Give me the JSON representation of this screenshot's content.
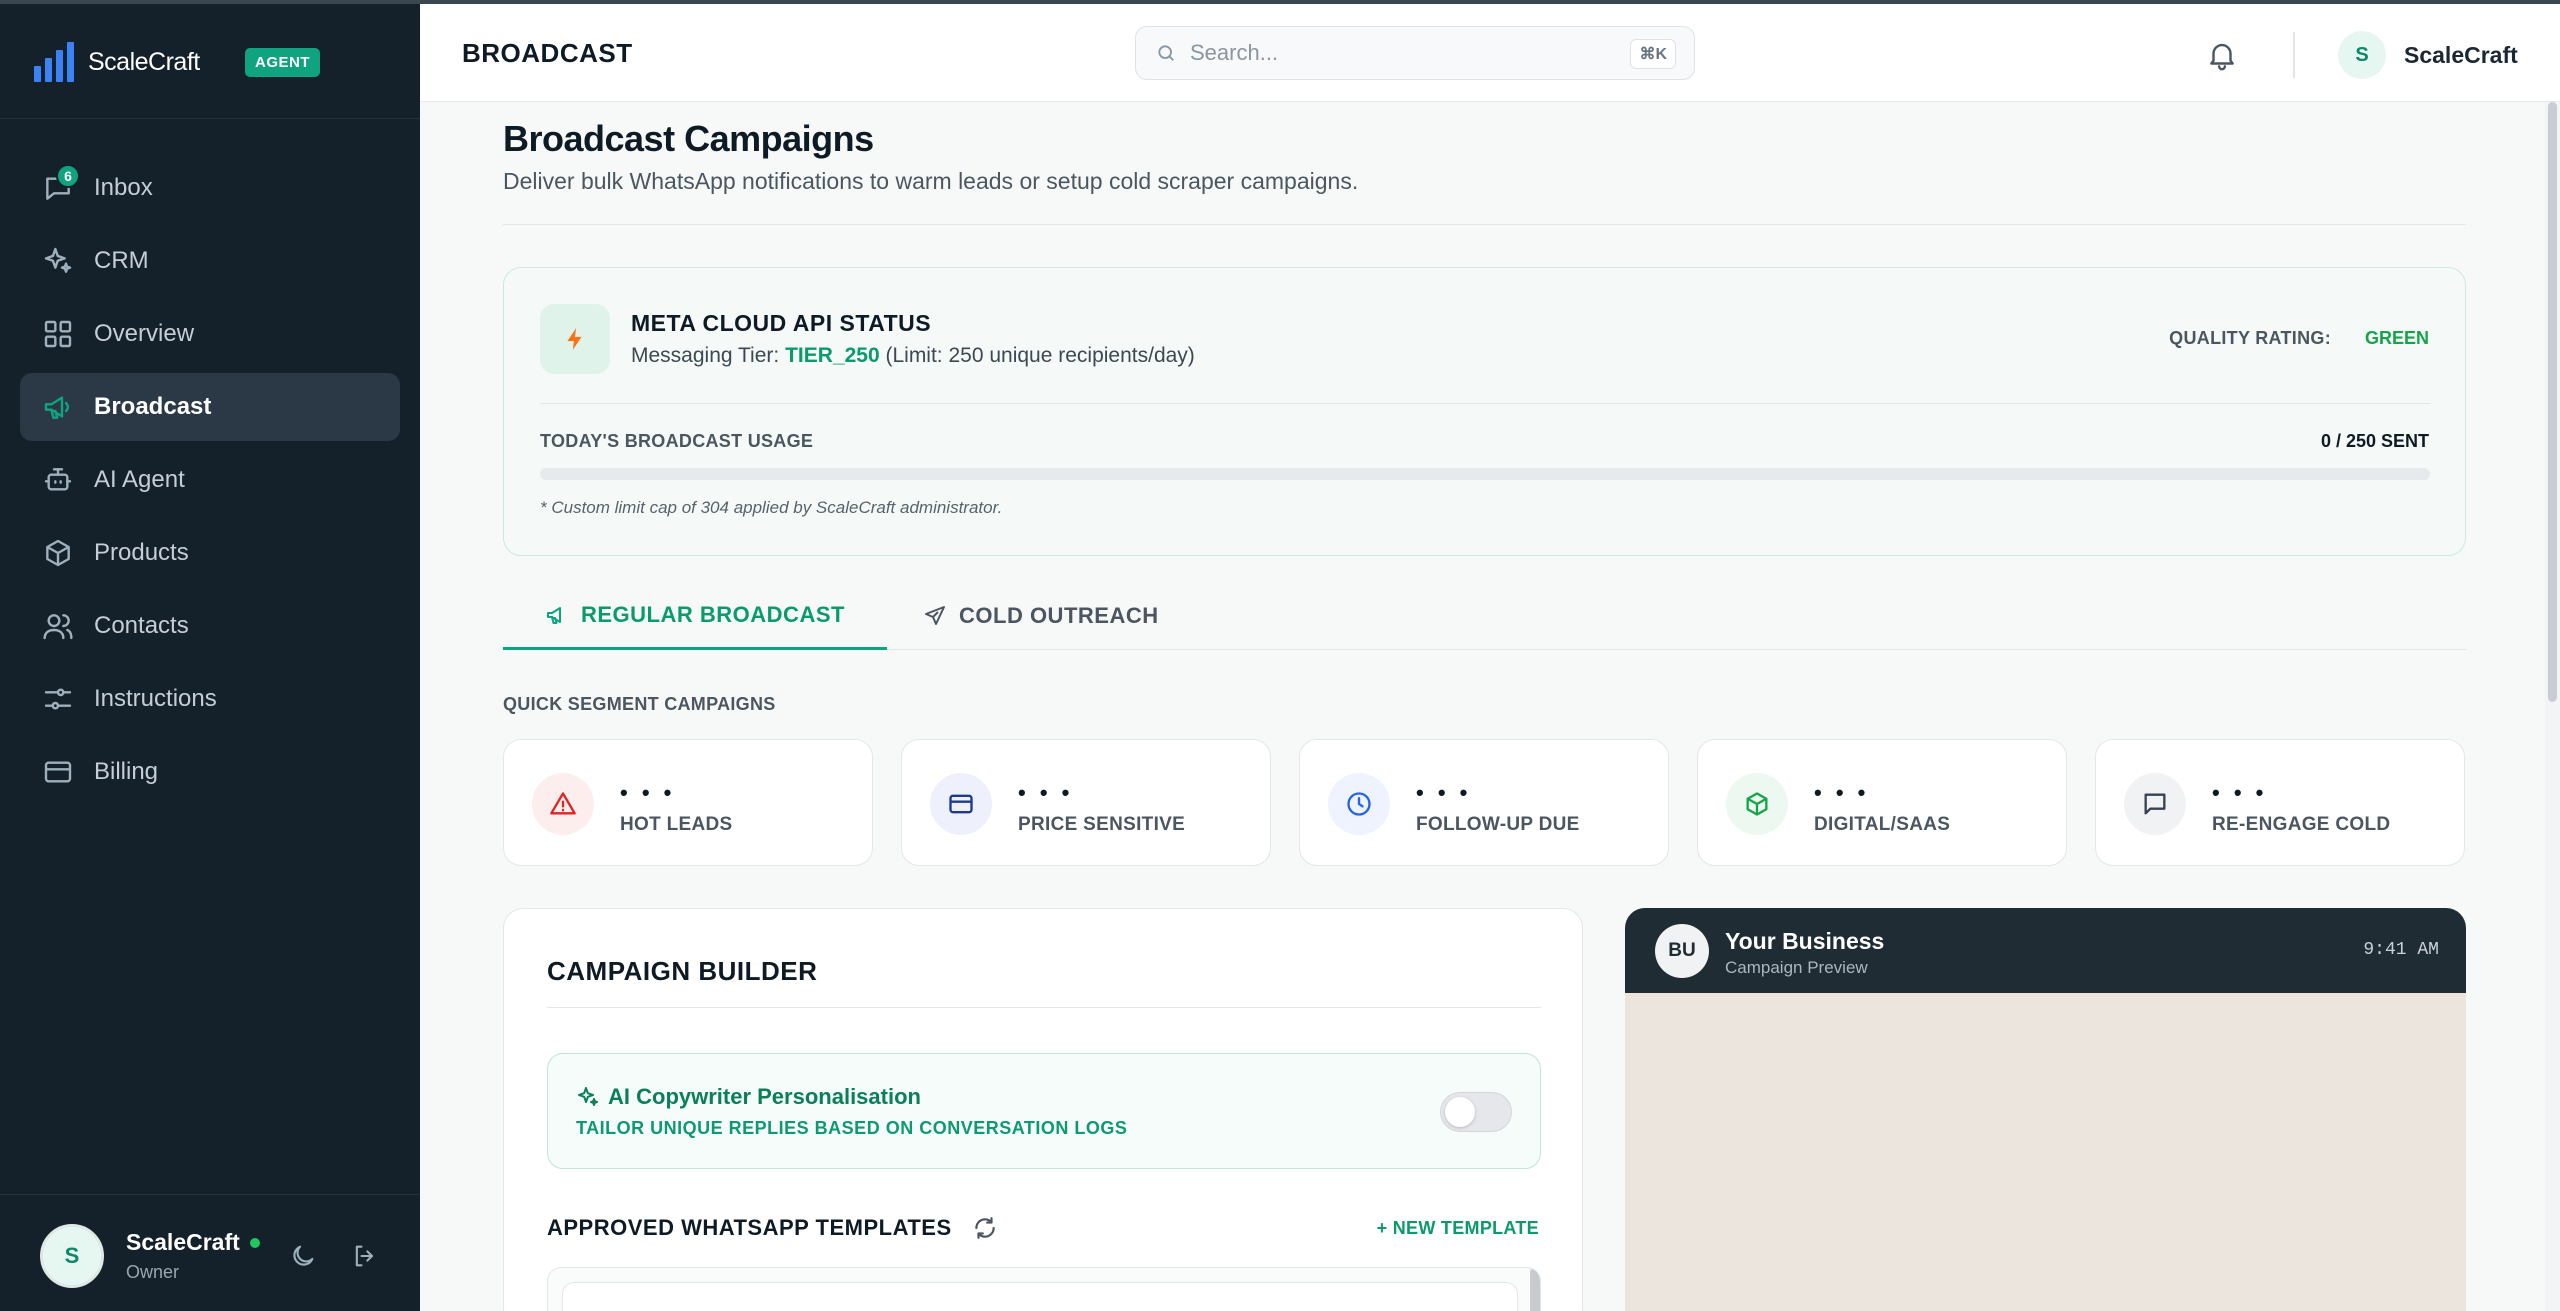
{
  "sidebar": {
    "brand": "ScaleCraft",
    "badge": "AGENT",
    "items": [
      {
        "label": "Inbox",
        "icon": "chat-icon",
        "badge": "6"
      },
      {
        "label": "CRM",
        "icon": "sparkles-icon"
      },
      {
        "label": "Overview",
        "icon": "grid-icon"
      },
      {
        "label": "Broadcast",
        "icon": "megaphone-icon",
        "active": true
      },
      {
        "label": "AI Agent",
        "icon": "bot-icon"
      },
      {
        "label": "Products",
        "icon": "box-icon"
      },
      {
        "label": "Contacts",
        "icon": "users-icon"
      },
      {
        "label": "Instructions",
        "icon": "sliders-icon"
      },
      {
        "label": "Billing",
        "icon": "card-icon"
      }
    ],
    "user": {
      "initial": "S",
      "name": "ScaleCraft",
      "role": "Owner"
    }
  },
  "header": {
    "title": "BROADCAST",
    "search_placeholder": "Search...",
    "shortcut": "⌘K",
    "user_initial": "S",
    "user_name": "ScaleCraft"
  },
  "main": {
    "title": "Broadcast Campaigns",
    "subtitle": "Deliver bulk WhatsApp notifications to warm leads or setup cold scraper campaigns.",
    "status": {
      "title": "META CLOUD API STATUS",
      "tier_prefix": "Messaging Tier: ",
      "tier": "TIER_250",
      "tier_suffix": " (Limit: 250 unique recipients/day)",
      "quality_label": "QUALITY RATING:",
      "quality_value": "GREEN",
      "usage_label": "TODAY'S BROADCAST USAGE",
      "usage_value": "0 / 250 SENT",
      "usage_fraction": 0,
      "note": "* Custom limit cap of 304 applied by ScaleCraft administrator."
    },
    "tabs": [
      {
        "label": "REGULAR BROADCAST",
        "active": true
      },
      {
        "label": "COLD OUTREACH",
        "active": false
      }
    ],
    "segments_label": "QUICK SEGMENT CAMPAIGNS",
    "segments": [
      {
        "count": "• • •",
        "name": "HOT LEADS",
        "icon": "alert-triangle-icon",
        "color": "#dc2626",
        "bg": "#fdeeee"
      },
      {
        "count": "• • •",
        "name": "PRICE SENSITIVE",
        "icon": "credit-card-icon",
        "color": "#1e3a8a",
        "bg": "#eef1fb"
      },
      {
        "count": "• • •",
        "name": "FOLLOW-UP DUE",
        "icon": "clock-icon",
        "color": "#2563eb",
        "bg": "#eef3fd"
      },
      {
        "count": "• • •",
        "name": "DIGITAL/SAAS",
        "icon": "package-icon",
        "color": "#16a34a",
        "bg": "#ecf8f0"
      },
      {
        "count": "• • •",
        "name": "RE-ENGAGE COLD",
        "icon": "message-square-icon",
        "color": "#374151",
        "bg": "#f1f2f4"
      }
    ],
    "builder": {
      "title": "CAMPAIGN BUILDER",
      "ai_title": "AI Copywriter Personalisation",
      "ai_sub": "TAILOR UNIQUE REPLIES BASED ON CONVERSATION LOGS",
      "ai_enabled": false,
      "templates_title": "APPROVED WHATSAPP TEMPLATES",
      "new_template": "+ NEW TEMPLATE"
    },
    "preview": {
      "initials": "BU",
      "name": "Your Business",
      "sub": "Campaign Preview",
      "time": "9:41 AM"
    }
  },
  "colors": {
    "accent": "#10a37f",
    "sidebar": "#14202a",
    "preview_header": "#1f2c34"
  }
}
